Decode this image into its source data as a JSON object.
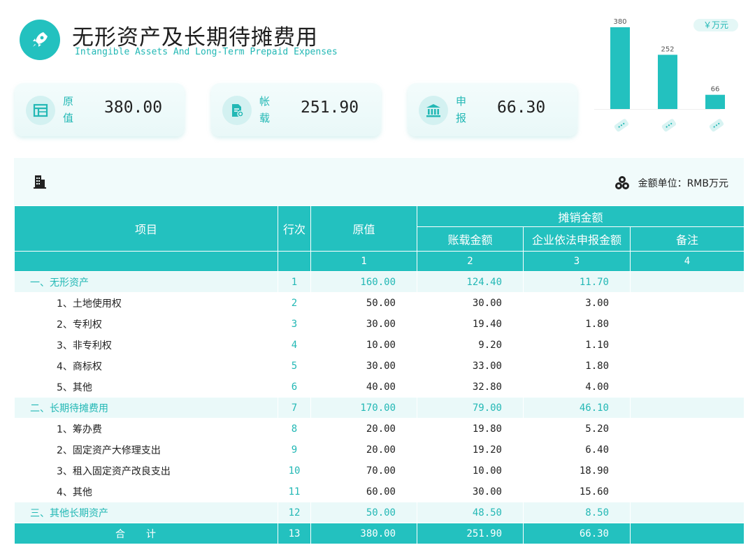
{
  "header": {
    "title": "无形资产及长期待摊费用",
    "subtitle": "Intangible Assets And Long-Term Prepaid Expenses",
    "logo_icon": "rocket-icon"
  },
  "cards": [
    {
      "label_1": "原",
      "label_2": "值",
      "value": "380.00",
      "icon": "table-icon"
    },
    {
      "label_1": "帐",
      "label_2": "载",
      "value": "251.90",
      "icon": "document-icon"
    },
    {
      "label_1": "申",
      "label_2": "报",
      "value": "66.30",
      "icon": "bank-icon"
    }
  ],
  "unit_badge": "￥万元",
  "chart_data": {
    "type": "bar",
    "categories": [
      "原值",
      "帐载",
      "申报"
    ],
    "values": [
      380,
      252,
      66
    ],
    "data_labels": [
      "380",
      "252",
      "66"
    ],
    "color": "#23c1bf"
  },
  "panel": {
    "unit_label": "金额单位：RMB万元",
    "building_icon": "building-icon",
    "coins_icon": "coins-icon"
  },
  "table": {
    "headers": {
      "item": "项目",
      "line": "行次",
      "original": "原值",
      "amortization": "摊销金额",
      "book": "账载金额",
      "declared": "企业依法申报金额",
      "remarks": "备注"
    },
    "column_numbers": [
      "1",
      "2",
      "3",
      "4"
    ],
    "rows": [
      {
        "item": "一、无形资产",
        "line": "1",
        "original": "160.00",
        "book": "124.40",
        "declared": "11.70",
        "remarks": ""
      },
      {
        "item": "1、土地使用权",
        "line": "2",
        "original": "50.00",
        "book": "30.00",
        "declared": "3.00",
        "remarks": ""
      },
      {
        "item": "2、专利权",
        "line": "3",
        "original": "30.00",
        "book": "19.40",
        "declared": "1.80",
        "remarks": ""
      },
      {
        "item": "3、非专利权",
        "line": "4",
        "original": "10.00",
        "book": "9.20",
        "declared": "1.10",
        "remarks": ""
      },
      {
        "item": "4、商标权",
        "line": "5",
        "original": "30.00",
        "book": "33.00",
        "declared": "1.80",
        "remarks": ""
      },
      {
        "item": "5、其他",
        "line": "6",
        "original": "40.00",
        "book": "32.80",
        "declared": "4.00",
        "remarks": ""
      },
      {
        "item": "二、长期待摊费用",
        "line": "7",
        "original": "170.00",
        "book": "79.00",
        "declared": "46.10",
        "remarks": ""
      },
      {
        "item": "1、筹办费",
        "line": "8",
        "original": "20.00",
        "book": "19.80",
        "declared": "5.20",
        "remarks": ""
      },
      {
        "item": "2、固定资产大修理支出",
        "line": "9",
        "original": "20.00",
        "book": "19.20",
        "declared": "6.40",
        "remarks": ""
      },
      {
        "item": "3、租入固定资产改良支出",
        "line": "10",
        "original": "70.00",
        "book": "10.00",
        "declared": "18.90",
        "remarks": ""
      },
      {
        "item": "4、其他",
        "line": "11",
        "original": "60.00",
        "book": "30.00",
        "declared": "15.60",
        "remarks": ""
      },
      {
        "item": "三、其他长期资产",
        "line": "12",
        "original": "50.00",
        "book": "48.50",
        "declared": "8.50",
        "remarks": ""
      }
    ],
    "total": {
      "item": "合计",
      "line": "13",
      "original": "380.00",
      "book": "251.90",
      "declared": "66.30",
      "remarks": ""
    }
  }
}
